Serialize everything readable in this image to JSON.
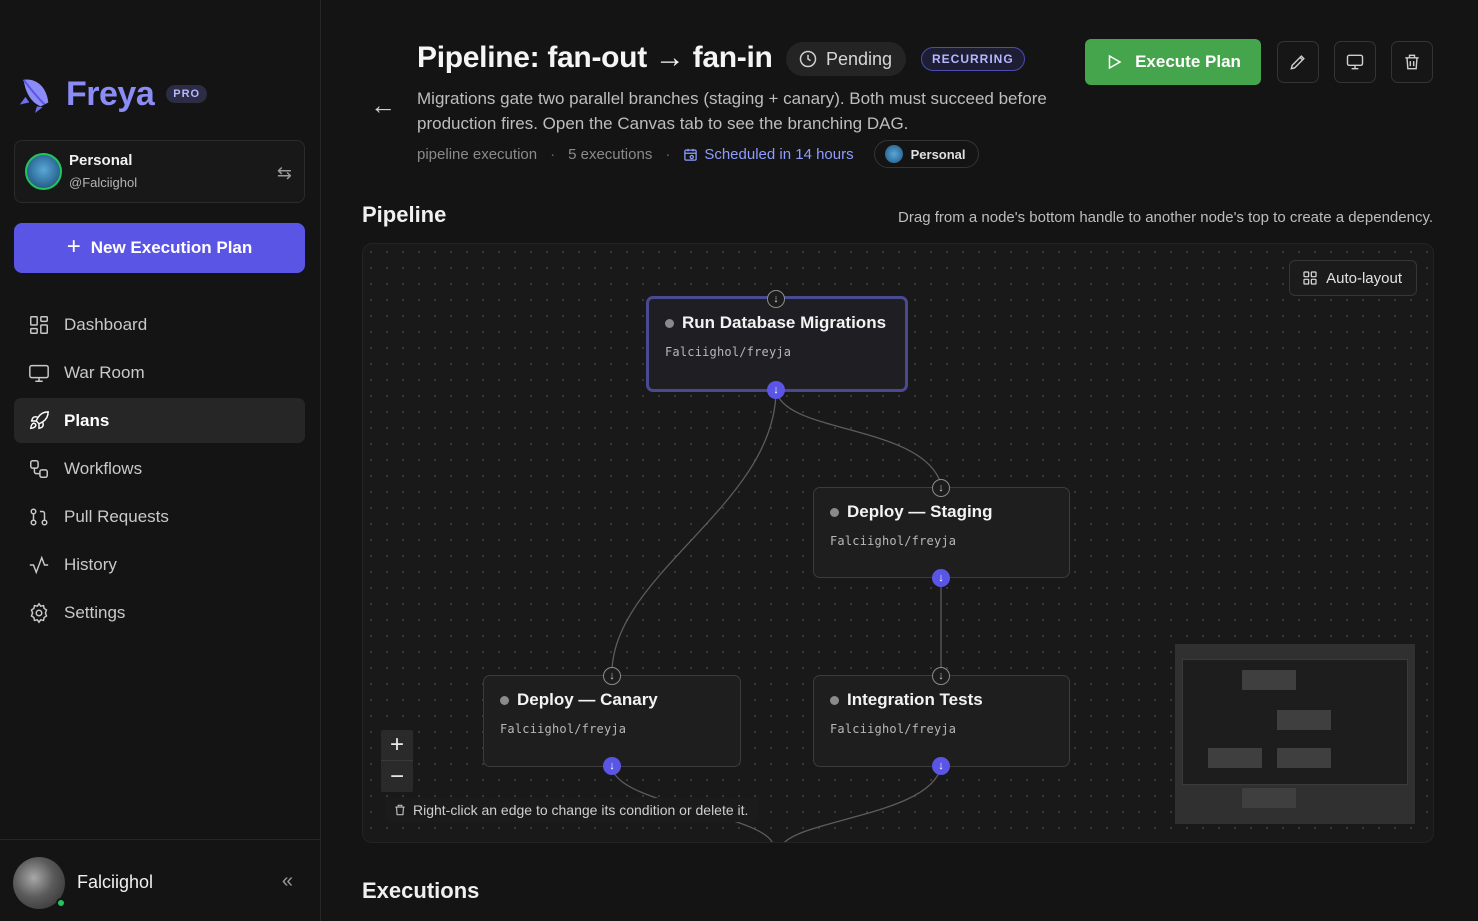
{
  "app": {
    "brand": "Freya",
    "tier_badge": "PRO",
    "accent_color": "#5b55e6"
  },
  "account": {
    "name": "Personal",
    "handle": "@Falciighol",
    "switch_icon": "switch-arrows-icon"
  },
  "sidebar": {
    "new_plan_label": "New Execution Plan",
    "items": [
      {
        "label": "Dashboard",
        "icon": "dashboard-grid-icon",
        "active": false
      },
      {
        "label": "War Room",
        "icon": "monitor-icon",
        "active": false
      },
      {
        "label": "Plans",
        "icon": "rocket-icon",
        "active": true
      },
      {
        "label": "Workflows",
        "icon": "workflow-icon",
        "active": false
      },
      {
        "label": "Pull Requests",
        "icon": "git-pull-request-icon",
        "active": false
      },
      {
        "label": "History",
        "icon": "activity-icon",
        "active": false
      },
      {
        "label": "Settings",
        "icon": "gear-icon",
        "active": false
      }
    ]
  },
  "user": {
    "name": "Falciighol",
    "status_color": "#22c55e"
  },
  "plan": {
    "title": "Pipeline: fan-out → fan-in",
    "status": "Pending",
    "recurring_badge": "RECURRING",
    "description": "Migrations gate two parallel branches (staging + canary). Both must succeed before production fires. Open the Canvas tab to see the branching DAG.",
    "meta": {
      "type": "pipeline execution",
      "executions": "5 executions",
      "schedule": "Scheduled in 14 hours",
      "workspace": "Personal"
    },
    "execute_label": "Execute Plan",
    "execute_color": "#44a54d"
  },
  "pipeline": {
    "section_title": "Pipeline",
    "hint": "Drag from a node's bottom handle to another node's top to create a dependency.",
    "auto_layout_label": "Auto-layout",
    "edge_hint": "Right-click an edge to change its condition or delete it.",
    "nodes": [
      {
        "title": "Run Database Migrations",
        "repo": "Falciighol/freyja"
      },
      {
        "title": "Deploy — Staging",
        "repo": "Falciighol/freyja"
      },
      {
        "title": "Deploy — Canary",
        "repo": "Falciighol/freyja"
      },
      {
        "title": "Integration Tests",
        "repo": "Falciighol/freyja"
      }
    ],
    "zoom_in": "+",
    "zoom_out": "−"
  },
  "executions": {
    "section_title": "Executions"
  }
}
